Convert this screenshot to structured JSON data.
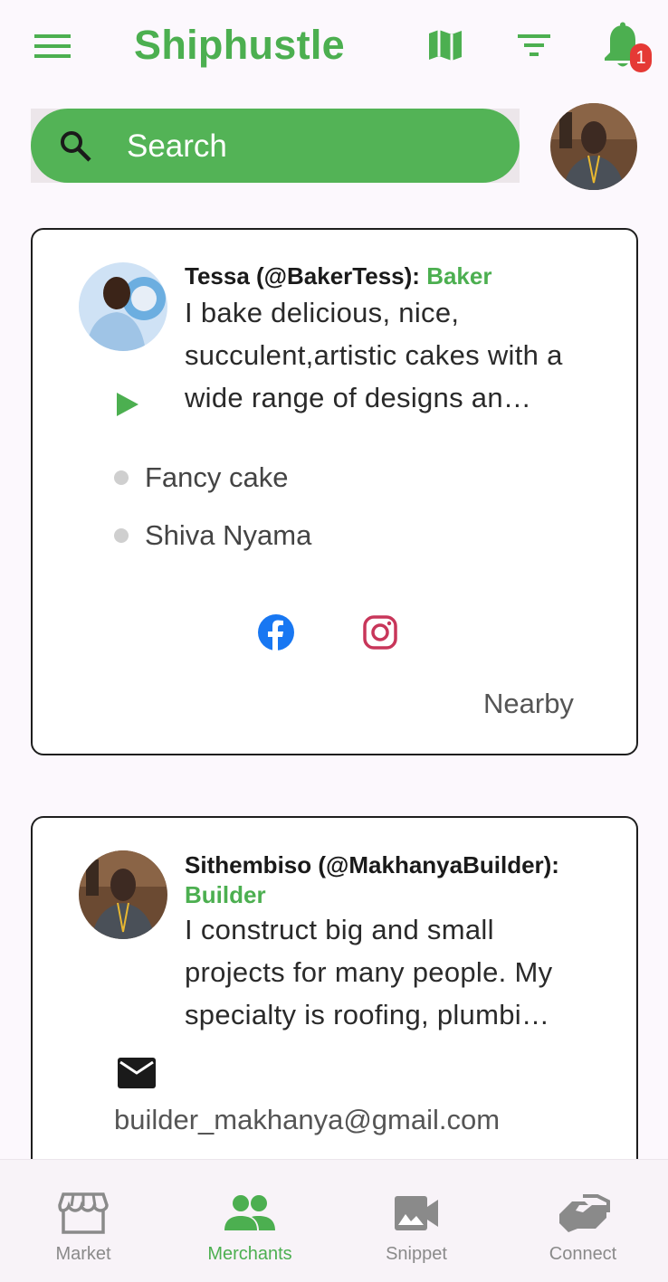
{
  "app": {
    "title": "Shiphustle",
    "notification_count": "1",
    "accent_color": "#4caf50"
  },
  "search": {
    "label": "Search"
  },
  "merchants": [
    {
      "name_handle": "Tessa (@BakerTess): ",
      "role": "Baker",
      "description": "I bake delicious,  nice, succulent,artistic cakes with a wide range of designs an…",
      "products": [
        "Fancy cake",
        "Shiva Nyama"
      ],
      "socials": [
        "facebook-icon",
        "instagram-icon"
      ],
      "distance": "Nearby"
    },
    {
      "name_handle": "Sithembiso (@MakhanyaBuilder):",
      "role": "Builder",
      "description": "I construct big and small projects for many people. My specialty is roofing, plumbi…",
      "email": "builder_makhanya@gmail.com"
    }
  ],
  "bottom_nav": {
    "items": [
      {
        "label": "Market",
        "icon": "storefront-icon",
        "active": false
      },
      {
        "label": "Merchants",
        "icon": "people-icon",
        "active": true
      },
      {
        "label": "Snippet",
        "icon": "video-camera-icon",
        "active": false
      },
      {
        "label": "Connect",
        "icon": "handshake-icon",
        "active": false
      }
    ]
  }
}
